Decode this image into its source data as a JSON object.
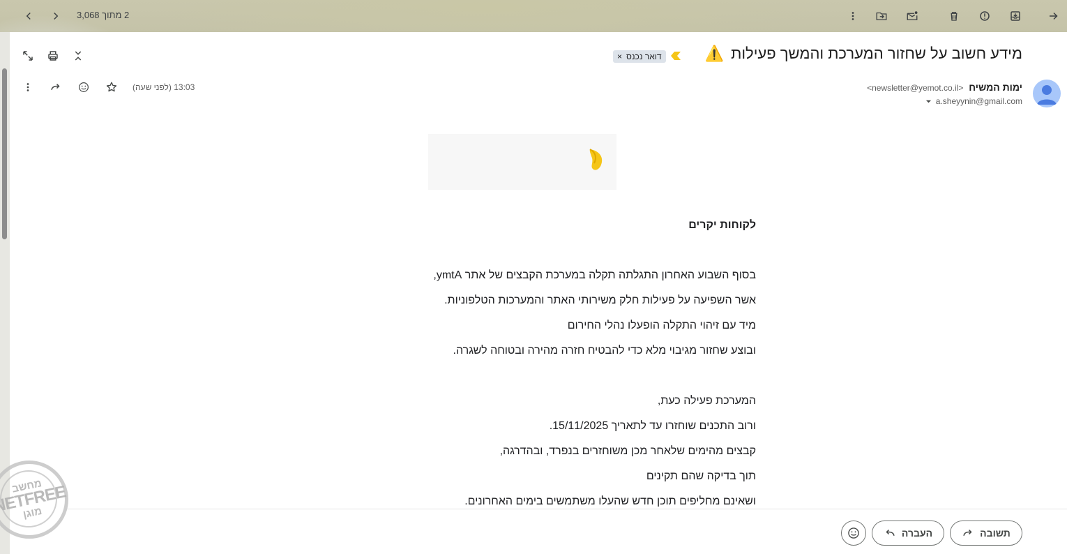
{
  "toolbar": {
    "counter": "2 מתוך 3,068",
    "back_icon": "arrow-right-icon",
    "archive_icon": "archive-icon",
    "spam_icon": "report-spam-icon",
    "delete_icon": "trash-icon",
    "mark_unread_icon": "mark-unread-icon",
    "move_icon": "move-to-folder-icon",
    "more_icon": "more-vert-icon"
  },
  "message": {
    "subject": "מידע חשוב על שחזור המערכת והמשך פעילות",
    "subject_emoji": "⚠️",
    "label_chip": "דואר נכנס",
    "label_remove": "×",
    "sender_name": "ימות המשיח",
    "sender_email": "<newsletter@yemot.co.il>",
    "to": "a.sheyynin@gmail.com",
    "time": "13:03 (לפני שעה)",
    "body": {
      "greeting": "לקוחות יקרים",
      "paragraph1": [
        "בסוף השבוע האחרון התגלתה תקלה במערכת הקבצים של אתר ymtA,",
        "אשר השפיעה על פעילות חלק משירותי האתר והמערכות הטלפוניות.",
        "מיד עם זיהוי התקלה הופעלו נהלי החירום",
        "ובוצע שחזור מגיבוי מלא כדי להבטיח חזרה מהירה ובטוחה לשגרה."
      ],
      "paragraph2": [
        "המערכת פעילה כעת,",
        "ורוב התכנים שוחזרו עד לתאריך 15/11/2025.",
        "קבצים מהימים שלאחר מכן משוחזרים בנפרד, ובהדרגה,",
        "תוך בדיקה שהם תקינים",
        "ושאינם מחליפים תוכן חדש שהעלו משתמשים בימים האחרונים."
      ]
    }
  },
  "actions": {
    "reply_label": "תשובה",
    "forward_label": "העברה"
  },
  "stamp": {
    "top": "מחשב",
    "middle": "NETFREE",
    "bottom": "מוגן"
  },
  "colors": {
    "accent_yellow": "#f5c518",
    "chip_bg": "#dde3ea",
    "avatar_bg": "#a8c7fa",
    "avatar_fg": "#4a7be0"
  }
}
